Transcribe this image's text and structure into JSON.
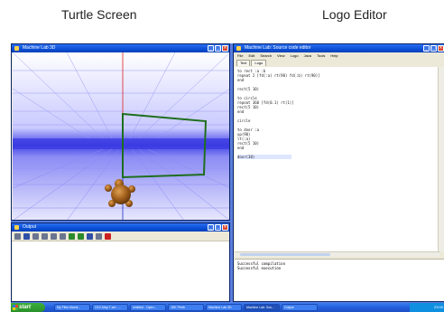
{
  "captions": {
    "turtle_screen": "Turtle Screen",
    "logo_editor": "Logo Editor"
  },
  "windows": {
    "machine3d": {
      "title": "Machine Lab 3D"
    },
    "output": {
      "title": "Output"
    },
    "editor": {
      "title": "Machine Lab: Source code editor",
      "menu": [
        "File",
        "Edit",
        "Search",
        "View",
        "Logo",
        "Java",
        "Tools",
        "Help"
      ],
      "tabs": [
        "Text",
        "Logo"
      ],
      "code_lines": [
        "to rect :a :b",
        "repeat 2 [fd(:a) rt(90) fd(:b) rt(90)]",
        "end",
        "",
        "rect(5 10)",
        "",
        "to circle",
        "repeat 360 [fd(0.1) rt(1)]",
        "rect(5 10)",
        "end",
        "",
        "circle",
        "",
        "to door :a",
        "up(90)",
        "lt(:a)",
        "rect(5 10)",
        "end",
        "",
        "door(30)"
      ],
      "status_lines": [
        "Successful compilation",
        "Successful execution"
      ]
    }
  },
  "taskbar": {
    "start_label": "start",
    "tasks": [
      "My Files Machi...",
      "CK2-Map T-ser -...",
      "Untitled - Open...",
      "JDK Perth",
      "Machine Lab 3D",
      "Machine Lab: Sou...",
      "Output"
    ],
    "clock": "23:00"
  },
  "colors": {
    "shape_line": "#1e6e1e",
    "horizon_fog": "#3a3ae0",
    "grid_line": "#7f7ff0",
    "axis_red": "#e02020",
    "axis_blue": "#2030c0",
    "turtle": "#9a5a18"
  }
}
